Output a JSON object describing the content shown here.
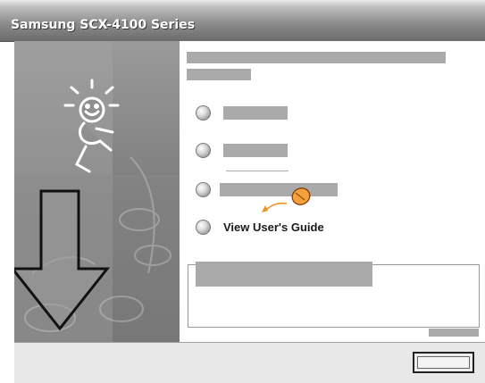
{
  "window": {
    "title": "Samsung SCX-4100 Series"
  },
  "menu": {
    "items": [
      {
        "label": "",
        "redacted": true
      },
      {
        "label": "",
        "redacted": true
      },
      {
        "label": "",
        "redacted": true
      },
      {
        "label": "View User's Guide",
        "redacted": false
      }
    ]
  },
  "colors": {
    "title_text": "#ffffff",
    "redaction": "#aaaaaa",
    "cursor_accent": "#f28c1a",
    "panel_gray": "#8c8c8c"
  },
  "icons": {
    "menu_bullet": "radio-bullet-icon",
    "cursor": "mouse-cursor-icon",
    "mascot": "running-figure-icon",
    "arrow": "down-arrow-icon"
  }
}
